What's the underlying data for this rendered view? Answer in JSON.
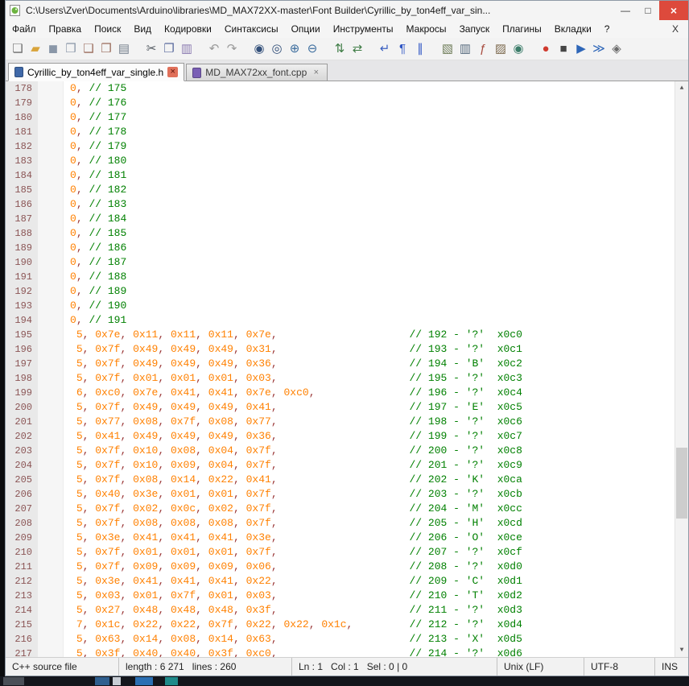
{
  "window": {
    "title": "C:\\Users\\Zver\\Documents\\Arduino\\libraries\\MD_MAX72XX-master\\Font Builder\\Cyrillic_by_ton4eff_var_sin...",
    "controls": {
      "minimize": "—",
      "maximize": "□",
      "close": "×"
    }
  },
  "menu": {
    "items": [
      "Файл",
      "Правка",
      "Поиск",
      "Вид",
      "Кодировки",
      "Синтаксисы",
      "Опции",
      "Инструменты",
      "Макросы",
      "Запуск",
      "Плагины",
      "Вкладки",
      "?"
    ],
    "right_close": "X"
  },
  "toolbar": {
    "items": [
      {
        "name": "new-file",
        "glyph": "❏",
        "color": "#6b6b6b"
      },
      {
        "name": "open-folder",
        "glyph": "▰",
        "color": "#d9a43b"
      },
      {
        "name": "save-file",
        "glyph": "◼",
        "color": "#8a97a8"
      },
      {
        "name": "save-all",
        "glyph": "❒",
        "color": "#8a97a8"
      },
      {
        "name": "close-file",
        "glyph": "❑",
        "color": "#9a6b5b"
      },
      {
        "name": "close-all",
        "glyph": "❒",
        "color": "#9a6b5b"
      },
      {
        "name": "print",
        "glyph": "▤",
        "color": "#76808e"
      },
      {
        "name": "cut",
        "glyph": "✂",
        "color": "#51585f",
        "gap": true
      },
      {
        "name": "copy",
        "glyph": "❐",
        "color": "#5a6b9e"
      },
      {
        "name": "paste",
        "glyph": "▥",
        "color": "#8a7ab0"
      },
      {
        "name": "undo",
        "glyph": "↶",
        "color": "#9a9a9a",
        "gap": true
      },
      {
        "name": "redo",
        "glyph": "↷",
        "color": "#9a9a9a"
      },
      {
        "name": "find",
        "glyph": "◉",
        "color": "#33507a",
        "gap": true
      },
      {
        "name": "replace",
        "glyph": "◎",
        "color": "#33507a"
      },
      {
        "name": "zoom-in",
        "glyph": "⊕",
        "color": "#3c6d9e"
      },
      {
        "name": "zoom-out",
        "glyph": "⊖",
        "color": "#3c6d9e"
      },
      {
        "name": "sync-vertical",
        "glyph": "⇅",
        "color": "#3f7d46",
        "gap": true
      },
      {
        "name": "sync-horizontal",
        "glyph": "⇄",
        "color": "#3f7d46"
      },
      {
        "name": "word-wrap",
        "glyph": "↵",
        "color": "#3a5fc0",
        "gap": true
      },
      {
        "name": "show-all-characters",
        "glyph": "¶",
        "color": "#2e55c4"
      },
      {
        "name": "indent-guide",
        "glyph": "∥",
        "color": "#2e55c4"
      },
      {
        "name": "user-language-dialog",
        "glyph": "▧",
        "color": "#6f7d59",
        "gap": true
      },
      {
        "name": "doc-map",
        "glyph": "▥",
        "color": "#566a7e"
      },
      {
        "name": "function-list",
        "glyph": "ƒ",
        "color": "#a84c3f"
      },
      {
        "name": "folder-as-workspace",
        "glyph": "▨",
        "color": "#7d6a4f"
      },
      {
        "name": "monitoring-eye",
        "glyph": "◉",
        "color": "#3d7d6a"
      },
      {
        "name": "record-macro",
        "glyph": "●",
        "color": "#cf3a2e",
        "gap": true
      },
      {
        "name": "stop-recording",
        "glyph": "■",
        "color": "#454545"
      },
      {
        "name": "playback-macro",
        "glyph": "▶",
        "color": "#2e66b8"
      },
      {
        "name": "run-macro-multiple",
        "glyph": "≫",
        "color": "#2e66b8"
      },
      {
        "name": "save-macro",
        "glyph": "◈",
        "color": "#6b6b6b"
      }
    ]
  },
  "tab_close_glyph": "×",
  "tabs": [
    {
      "label": "Cyrillic_by_ton4eff_var_single.h",
      "active": true,
      "icon_color": "#3f68a8"
    },
    {
      "label": "MD_MAX72xx_font.cpp",
      "active": false,
      "icon_color": "#7a5fb5"
    }
  ],
  "editor": {
    "colors": {
      "number": "#ff8000",
      "operator": "#993333",
      "comment": "#008000",
      "linenumber": "#8b5555",
      "gutterbg": "#e9e9e9"
    },
    "lines": [
      {
        "n": 178,
        "code": "0,",
        "ccol": 3,
        "comment": "// 175"
      },
      {
        "n": 179,
        "code": "0,",
        "ccol": 3,
        "comment": "// 176"
      },
      {
        "n": 180,
        "code": "0,",
        "ccol": 3,
        "comment": "// 177"
      },
      {
        "n": 181,
        "code": "0,",
        "ccol": 3,
        "comment": "// 178"
      },
      {
        "n": 182,
        "code": "0,",
        "ccol": 3,
        "comment": "// 179"
      },
      {
        "n": 183,
        "code": "0,",
        "ccol": 3,
        "comment": "// 180"
      },
      {
        "n": 184,
        "code": "0,",
        "ccol": 3,
        "comment": "// 181"
      },
      {
        "n": 185,
        "code": "0,",
        "ccol": 3,
        "comment": "// 182"
      },
      {
        "n": 186,
        "code": "0,",
        "ccol": 3,
        "comment": "// 183"
      },
      {
        "n": 187,
        "code": "0,",
        "ccol": 3,
        "comment": "// 184"
      },
      {
        "n": 188,
        "code": "0,",
        "ccol": 3,
        "comment": "// 185"
      },
      {
        "n": 189,
        "code": "0,",
        "ccol": 3,
        "comment": "// 186"
      },
      {
        "n": 190,
        "code": "0,",
        "ccol": 3,
        "comment": "// 187"
      },
      {
        "n": 191,
        "code": "0,",
        "ccol": 3,
        "comment": "// 188"
      },
      {
        "n": 192,
        "code": "0,",
        "ccol": 3,
        "comment": "// 189"
      },
      {
        "n": 193,
        "code": "0,",
        "ccol": 3,
        "comment": "// 190"
      },
      {
        "n": 194,
        "code": "0,",
        "ccol": 3,
        "comment": "// 191"
      },
      {
        "n": 195,
        "code": " 5, 0x7e, 0x11, 0x11, 0x11, 0x7e,",
        "ccol": 54,
        "comment": "// 192 - '?'  x0c0"
      },
      {
        "n": 196,
        "code": " 5, 0x7f, 0x49, 0x49, 0x49, 0x31,",
        "ccol": 54,
        "comment": "// 193 - '?'  x0c1"
      },
      {
        "n": 197,
        "code": " 5, 0x7f, 0x49, 0x49, 0x49, 0x36,",
        "ccol": 54,
        "comment": "// 194 - 'B'  x0c2"
      },
      {
        "n": 198,
        "code": " 5, 0x7f, 0x01, 0x01, 0x01, 0x03,",
        "ccol": 54,
        "comment": "// 195 - '?'  x0c3"
      },
      {
        "n": 199,
        "code": " 6, 0xc0, 0x7e, 0x41, 0x41, 0x7e, 0xc0,",
        "ccol": 54,
        "comment": "// 196 - '?'  x0c4"
      },
      {
        "n": 200,
        "code": " 5, 0x7f, 0x49, 0x49, 0x49, 0x41,",
        "ccol": 54,
        "comment": "// 197 - 'E'  x0c5"
      },
      {
        "n": 201,
        "code": " 5, 0x77, 0x08, 0x7f, 0x08, 0x77,",
        "ccol": 54,
        "comment": "// 198 - '?'  x0c6"
      },
      {
        "n": 202,
        "code": " 5, 0x41, 0x49, 0x49, 0x49, 0x36,",
        "ccol": 54,
        "comment": "// 199 - '?'  x0c7"
      },
      {
        "n": 203,
        "code": " 5, 0x7f, 0x10, 0x08, 0x04, 0x7f,",
        "ccol": 54,
        "comment": "// 200 - '?'  x0c8"
      },
      {
        "n": 204,
        "code": " 5, 0x7f, 0x10, 0x09, 0x04, 0x7f,",
        "ccol": 54,
        "comment": "// 201 - '?'  x0c9"
      },
      {
        "n": 205,
        "code": " 5, 0x7f, 0x08, 0x14, 0x22, 0x41,",
        "ccol": 54,
        "comment": "// 202 - 'K'  x0ca"
      },
      {
        "n": 206,
        "code": " 5, 0x40, 0x3e, 0x01, 0x01, 0x7f,",
        "ccol": 54,
        "comment": "// 203 - '?'  x0cb"
      },
      {
        "n": 207,
        "code": " 5, 0x7f, 0x02, 0x0c, 0x02, 0x7f,",
        "ccol": 54,
        "comment": "// 204 - 'M'  x0cc"
      },
      {
        "n": 208,
        "code": " 5, 0x7f, 0x08, 0x08, 0x08, 0x7f,",
        "ccol": 54,
        "comment": "// 205 - 'H'  x0cd"
      },
      {
        "n": 209,
        "code": " 5, 0x3e, 0x41, 0x41, 0x41, 0x3e,",
        "ccol": 54,
        "comment": "// 206 - 'O'  x0ce"
      },
      {
        "n": 210,
        "code": " 5, 0x7f, 0x01, 0x01, 0x01, 0x7f,",
        "ccol": 54,
        "comment": "// 207 - '?'  x0cf"
      },
      {
        "n": 211,
        "code": " 5, 0x7f, 0x09, 0x09, 0x09, 0x06,",
        "ccol": 54,
        "comment": "// 208 - '?'  x0d0"
      },
      {
        "n": 212,
        "code": " 5, 0x3e, 0x41, 0x41, 0x41, 0x22,",
        "ccol": 54,
        "comment": "// 209 - 'C'  x0d1"
      },
      {
        "n": 213,
        "code": " 5, 0x03, 0x01, 0x7f, 0x01, 0x03,",
        "ccol": 54,
        "comment": "// 210 - 'T'  x0d2"
      },
      {
        "n": 214,
        "code": " 5, 0x27, 0x48, 0x48, 0x48, 0x3f,",
        "ccol": 54,
        "comment": "// 211 - '?'  x0d3"
      },
      {
        "n": 215,
        "code": " 7, 0x1c, 0x22, 0x22, 0x7f, 0x22, 0x22, 0x1c,",
        "ccol": 54,
        "comment": "// 212 - '?'  x0d4"
      },
      {
        "n": 216,
        "code": " 5, 0x63, 0x14, 0x08, 0x14, 0x63,",
        "ccol": 54,
        "comment": "// 213 - 'X'  x0d5"
      },
      {
        "n": 217,
        "code": " 5, 0x3f, 0x40, 0x40, 0x3f, 0xc0,",
        "ccol": 54,
        "comment": "// 214 - '?'  x0d6"
      }
    ]
  },
  "scrollbar": {
    "up_glyph": "▲",
    "down_glyph": "▼"
  },
  "status": {
    "doc_type": "C++ source file",
    "length_lines": "length : 6 271   lines : 260",
    "cursor": "Ln : 1   Col : 1   Sel : 0 | 0",
    "eol": "Unix (LF)",
    "encoding": "UTF-8",
    "mode": "INS"
  }
}
